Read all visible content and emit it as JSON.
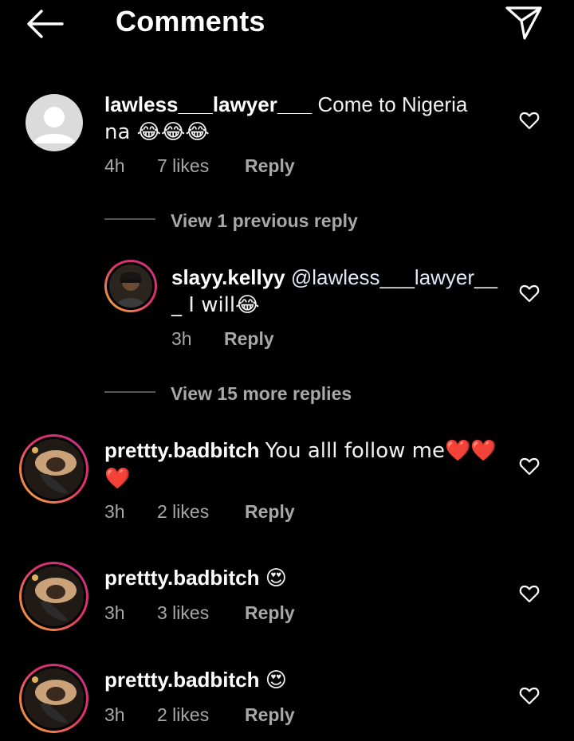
{
  "header": {
    "title": "Comments"
  },
  "comments": [
    {
      "username": "lawless___lawyer___",
      "text": "Come to Nigeria",
      "text_line2": "na 😂😂😂",
      "time": "4h",
      "likes": "7 likes",
      "reply": "Reply"
    },
    {
      "view_previous": "View 1 previous reply"
    },
    {
      "username": "slayy.kellyy",
      "mention": "@lawless___lawyer__",
      "text_line2": "_ I will😂",
      "time": "3h",
      "reply": "Reply"
    },
    {
      "view_more": "View 15 more replies"
    },
    {
      "username": "prettty.badbitch",
      "text": "You alll follow me❤️❤️",
      "text_line2": "❤️",
      "time": "3h",
      "likes": "2 likes",
      "reply": "Reply"
    },
    {
      "username": "prettty.badbitch",
      "text": "😍",
      "time": "3h",
      "likes": "3 likes",
      "reply": "Reply"
    },
    {
      "username": "prettty.badbitch",
      "text": "😍",
      "time": "3h",
      "likes": "2 likes",
      "reply": "Reply"
    }
  ],
  "colors": {
    "background": "#000000",
    "secondary_text": "#a8a8a8",
    "story_ring_start": "#f7b733",
    "story_ring_end": "#c13584"
  },
  "icons": {
    "back": "arrow-left-icon",
    "share": "paper-plane-icon",
    "like": "heart-outline-icon"
  }
}
